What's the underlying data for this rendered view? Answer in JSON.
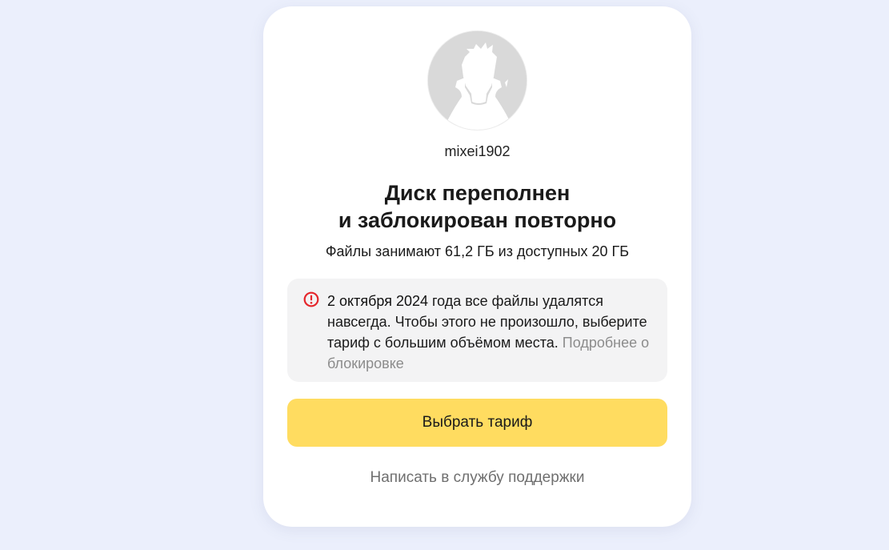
{
  "profile": {
    "username": "mixei1902",
    "avatar_icon": "default-user-silhouette-icon"
  },
  "status": {
    "title_line1": "Диск переполнен",
    "title_line2": "и заблокирован повторно",
    "usage_text": "Файлы занимают 61,2 ГБ из доступных 20 ГБ"
  },
  "notice": {
    "icon": "warning-circle-icon",
    "icon_color": "#e5262b",
    "date": "2 октября 2024",
    "text": " года все файлы удалятся навсегда. Чтобы этого не произошло, выберите тариф с большим объёмом места. ",
    "link_label": "Подробнее о блокировке"
  },
  "actions": {
    "choose_plan_label": "Выбрать тариф",
    "support_label": "Написать в службу поддержки"
  },
  "colors": {
    "page_background": "#ebeffc",
    "card_background": "#ffffff",
    "primary_button": "#ffdc60",
    "notice_background": "#f3f3f4",
    "link_gray": "#8c8c8c"
  }
}
